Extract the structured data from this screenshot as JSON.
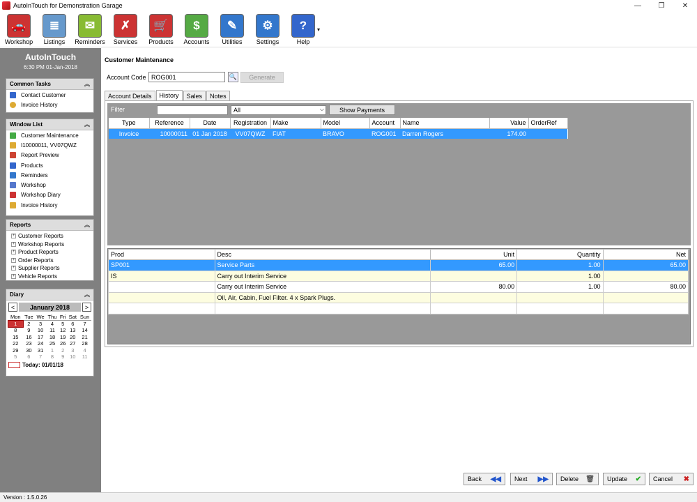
{
  "window": {
    "title": "AutoInTouch for Demonstration Garage"
  },
  "toolbar": [
    {
      "label": "Workshop",
      "color": "#cc3333",
      "icon": "car-icon",
      "glyph": "🚗"
    },
    {
      "label": "Listings",
      "color": "#6699cc",
      "icon": "listings-icon",
      "glyph": "≣"
    },
    {
      "label": "Reminders",
      "color": "#88bb33",
      "icon": "reminders-icon",
      "glyph": "✉"
    },
    {
      "label": "Services",
      "color": "#cc3333",
      "icon": "tools-icon",
      "glyph": "✗"
    },
    {
      "label": "Products",
      "color": "#cc3333",
      "icon": "cart-icon",
      "glyph": "🛒"
    },
    {
      "label": "Accounts",
      "color": "#55aa44",
      "icon": "money-icon",
      "glyph": "$"
    },
    {
      "label": "Utilities",
      "color": "#3377cc",
      "icon": "utilities-icon",
      "glyph": "✎"
    },
    {
      "label": "Settings",
      "color": "#3377cc",
      "icon": "settings-icon",
      "glyph": "⚙"
    },
    {
      "label": "Help",
      "color": "#3366cc",
      "icon": "help-icon",
      "glyph": "?"
    }
  ],
  "sidebar": {
    "brand": "AutoInTouch",
    "clock": "6:30 PM 01-Jan-2018",
    "common_tasks": {
      "title": "Common Tasks",
      "items": [
        "Contact Customer",
        "Invoice History"
      ]
    },
    "window_list": {
      "title": "Window List",
      "items": [
        "Customer Maintenance",
        "I10000011, VV07QWZ",
        "Report Preview",
        "Products",
        "Reminders",
        "Workshop",
        "Workshop Diary",
        "Invoice History"
      ]
    },
    "reports": {
      "title": "Reports",
      "items": [
        "Customer Reports",
        "Workshop Reports",
        "Product Reports",
        "Order Reports",
        "Supplier Reports",
        "Vehicle Reports"
      ]
    },
    "diary": {
      "title": "Diary",
      "month": "January 2018",
      "prev": "<",
      "next": ">",
      "days": [
        "Mon",
        "Tue",
        "We",
        "Thu",
        "Fri",
        "Sat",
        "Sun"
      ],
      "weeks": [
        [
          "1",
          "2",
          "3",
          "4",
          "5",
          "6",
          "7"
        ],
        [
          "8",
          "9",
          "10",
          "11",
          "12",
          "13",
          "14"
        ],
        [
          "15",
          "16",
          "17",
          "18",
          "19",
          "20",
          "21"
        ],
        [
          "22",
          "23",
          "24",
          "25",
          "26",
          "27",
          "28"
        ],
        [
          "29",
          "30",
          "31",
          "1",
          "2",
          "3",
          "4"
        ],
        [
          "5",
          "6",
          "7",
          "8",
          "9",
          "10",
          "11"
        ]
      ],
      "today": "Today: 01/01/18"
    }
  },
  "main": {
    "heading": "Customer Maintenance",
    "account_code_label": "Account Code",
    "account_code": "ROG001",
    "generate": "Generate",
    "tabs": [
      "Account Details",
      "History",
      "Sales",
      "Notes"
    ],
    "filter_label": "Filter",
    "filter_option": "All",
    "show_payments": "Show Payments",
    "history_columns": [
      "Type",
      "Reference",
      "Date",
      "Registration",
      "Make",
      "Model",
      "Account",
      "Name",
      "Value",
      "OrderRef"
    ],
    "history_rows": [
      [
        "Invoice",
        "10000011",
        "01 Jan 2018",
        "VV07QWZ",
        "FIAT",
        "BRAVO",
        "ROG001",
        "Darren Rogers",
        "174.00",
        ""
      ]
    ],
    "line_columns": [
      "Prod",
      "Desc",
      "Unit",
      "Quantity",
      "Net"
    ],
    "line_rows": [
      [
        "SP001",
        "Service Parts",
        "65.00",
        "1.00",
        "65.00"
      ],
      [
        "IS",
        "Carry out Interim Service",
        "",
        "1.00",
        ""
      ],
      [
        "",
        "Carry out Interim Service",
        "80.00",
        "1.00",
        "80.00"
      ],
      [
        "",
        "Oil, Air, Cabin, Fuel Filter. 4 x Spark Plugs.",
        "",
        "",
        ""
      ],
      [
        "",
        "",
        "",
        "",
        ""
      ]
    ],
    "buttons": {
      "back": "Back",
      "next": "Next",
      "delete": "Delete",
      "update": "Update",
      "cancel": "Cancel"
    }
  },
  "status": {
    "version": "Version : 1.5.0.26"
  }
}
